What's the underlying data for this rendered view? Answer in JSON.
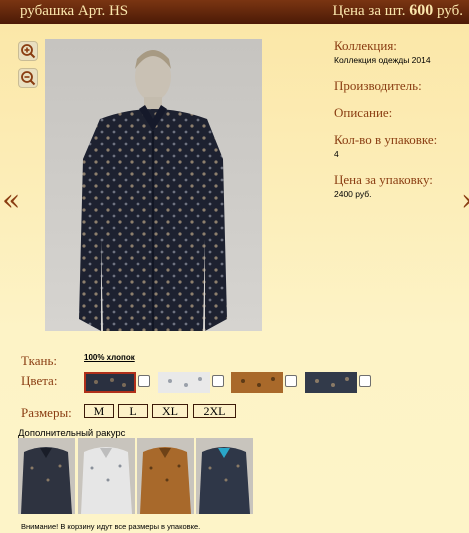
{
  "header": {
    "title": "рубашка Арт. HS",
    "price_prefix": "Цена за шт.",
    "price_value": "600",
    "price_unit": "руб."
  },
  "nav": {
    "prev_label": "«",
    "next_label": "»"
  },
  "zoom": {
    "in_icon": "zoom-in-icon",
    "out_icon": "zoom-out-icon"
  },
  "info": {
    "collection_label": "Коллекция:",
    "collection_value": "Коллекция одежды 2014",
    "manufacturer_label": "Производитель:",
    "description_label": "Описание:",
    "qty_label": "Кол-во в упаковке:",
    "qty_value": "4",
    "pack_price_label": "Цена за упаковку:",
    "pack_price_value": "2400 руб."
  },
  "fabric": {
    "label": "Ткань:",
    "value": "100% хлопок"
  },
  "colors": {
    "label": "Цвета:",
    "swatches": [
      {
        "color": "#2a3040",
        "selected": true
      },
      {
        "color": "#e9e9e9",
        "selected": false
      },
      {
        "color": "#a9692a",
        "selected": false
      },
      {
        "color": "#323a4a",
        "selected": false
      }
    ]
  },
  "sizes": {
    "label": "Размеры:",
    "options": [
      "M",
      "L",
      "XL",
      "2XL"
    ]
  },
  "extra_views": {
    "label": "Дополнительный ракурс",
    "thumbs": [
      "#2e3340",
      "#e6e6e6",
      "#a8692b",
      "#2f3748"
    ]
  },
  "note": "Внимание! В корзину идут все размеры в упаковке.",
  "colors_palette": {
    "accent": "#8a3d12",
    "header": "#5c230a",
    "background": "#fcefb4"
  }
}
